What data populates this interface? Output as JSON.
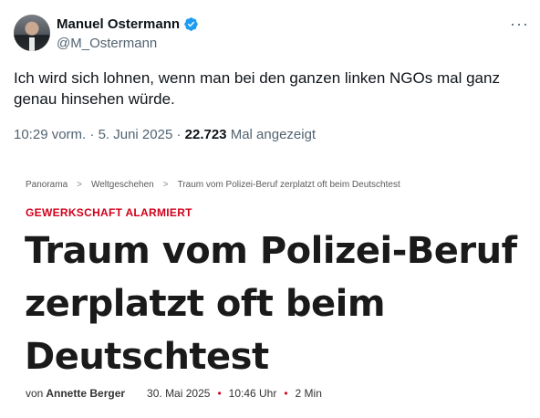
{
  "tweet": {
    "display_name": "Manuel Ostermann",
    "handle": "@M_Ostermann",
    "more_glyph": "···",
    "text": "Ich wird sich lohnen, wenn man bei den ganzen linken NGOs mal ganz genau hinsehen würde.",
    "time": "10:29 vorm.",
    "date": "5. Juni 2025",
    "views_count": "22.723",
    "views_label": "Mal angezeigt",
    "separator": "·",
    "icons": {
      "verified": "verified-badge-icon",
      "more": "more-options-icon"
    },
    "colors": {
      "verified": "#1d9bf0",
      "muted": "#536471"
    }
  },
  "article": {
    "breadcrumb": [
      "Panorama",
      "Weltgeschehen",
      "Traum vom Polizei-Beruf zerplatzt oft beim Deutschtest"
    ],
    "breadcrumb_separator": ">",
    "kicker": "GEWERKSCHAFT ALARMIERT",
    "headline": "Traum vom Polizei-Beruf zerplatzt oft beim Deutschtest",
    "byline_prefix": "von",
    "author": "Annette Berger",
    "date": "30. Mai 2025",
    "time": "10:46 Uhr",
    "reading_time": "2 Min",
    "bullet": "•",
    "colors": {
      "kicker": "#d0021b"
    }
  }
}
